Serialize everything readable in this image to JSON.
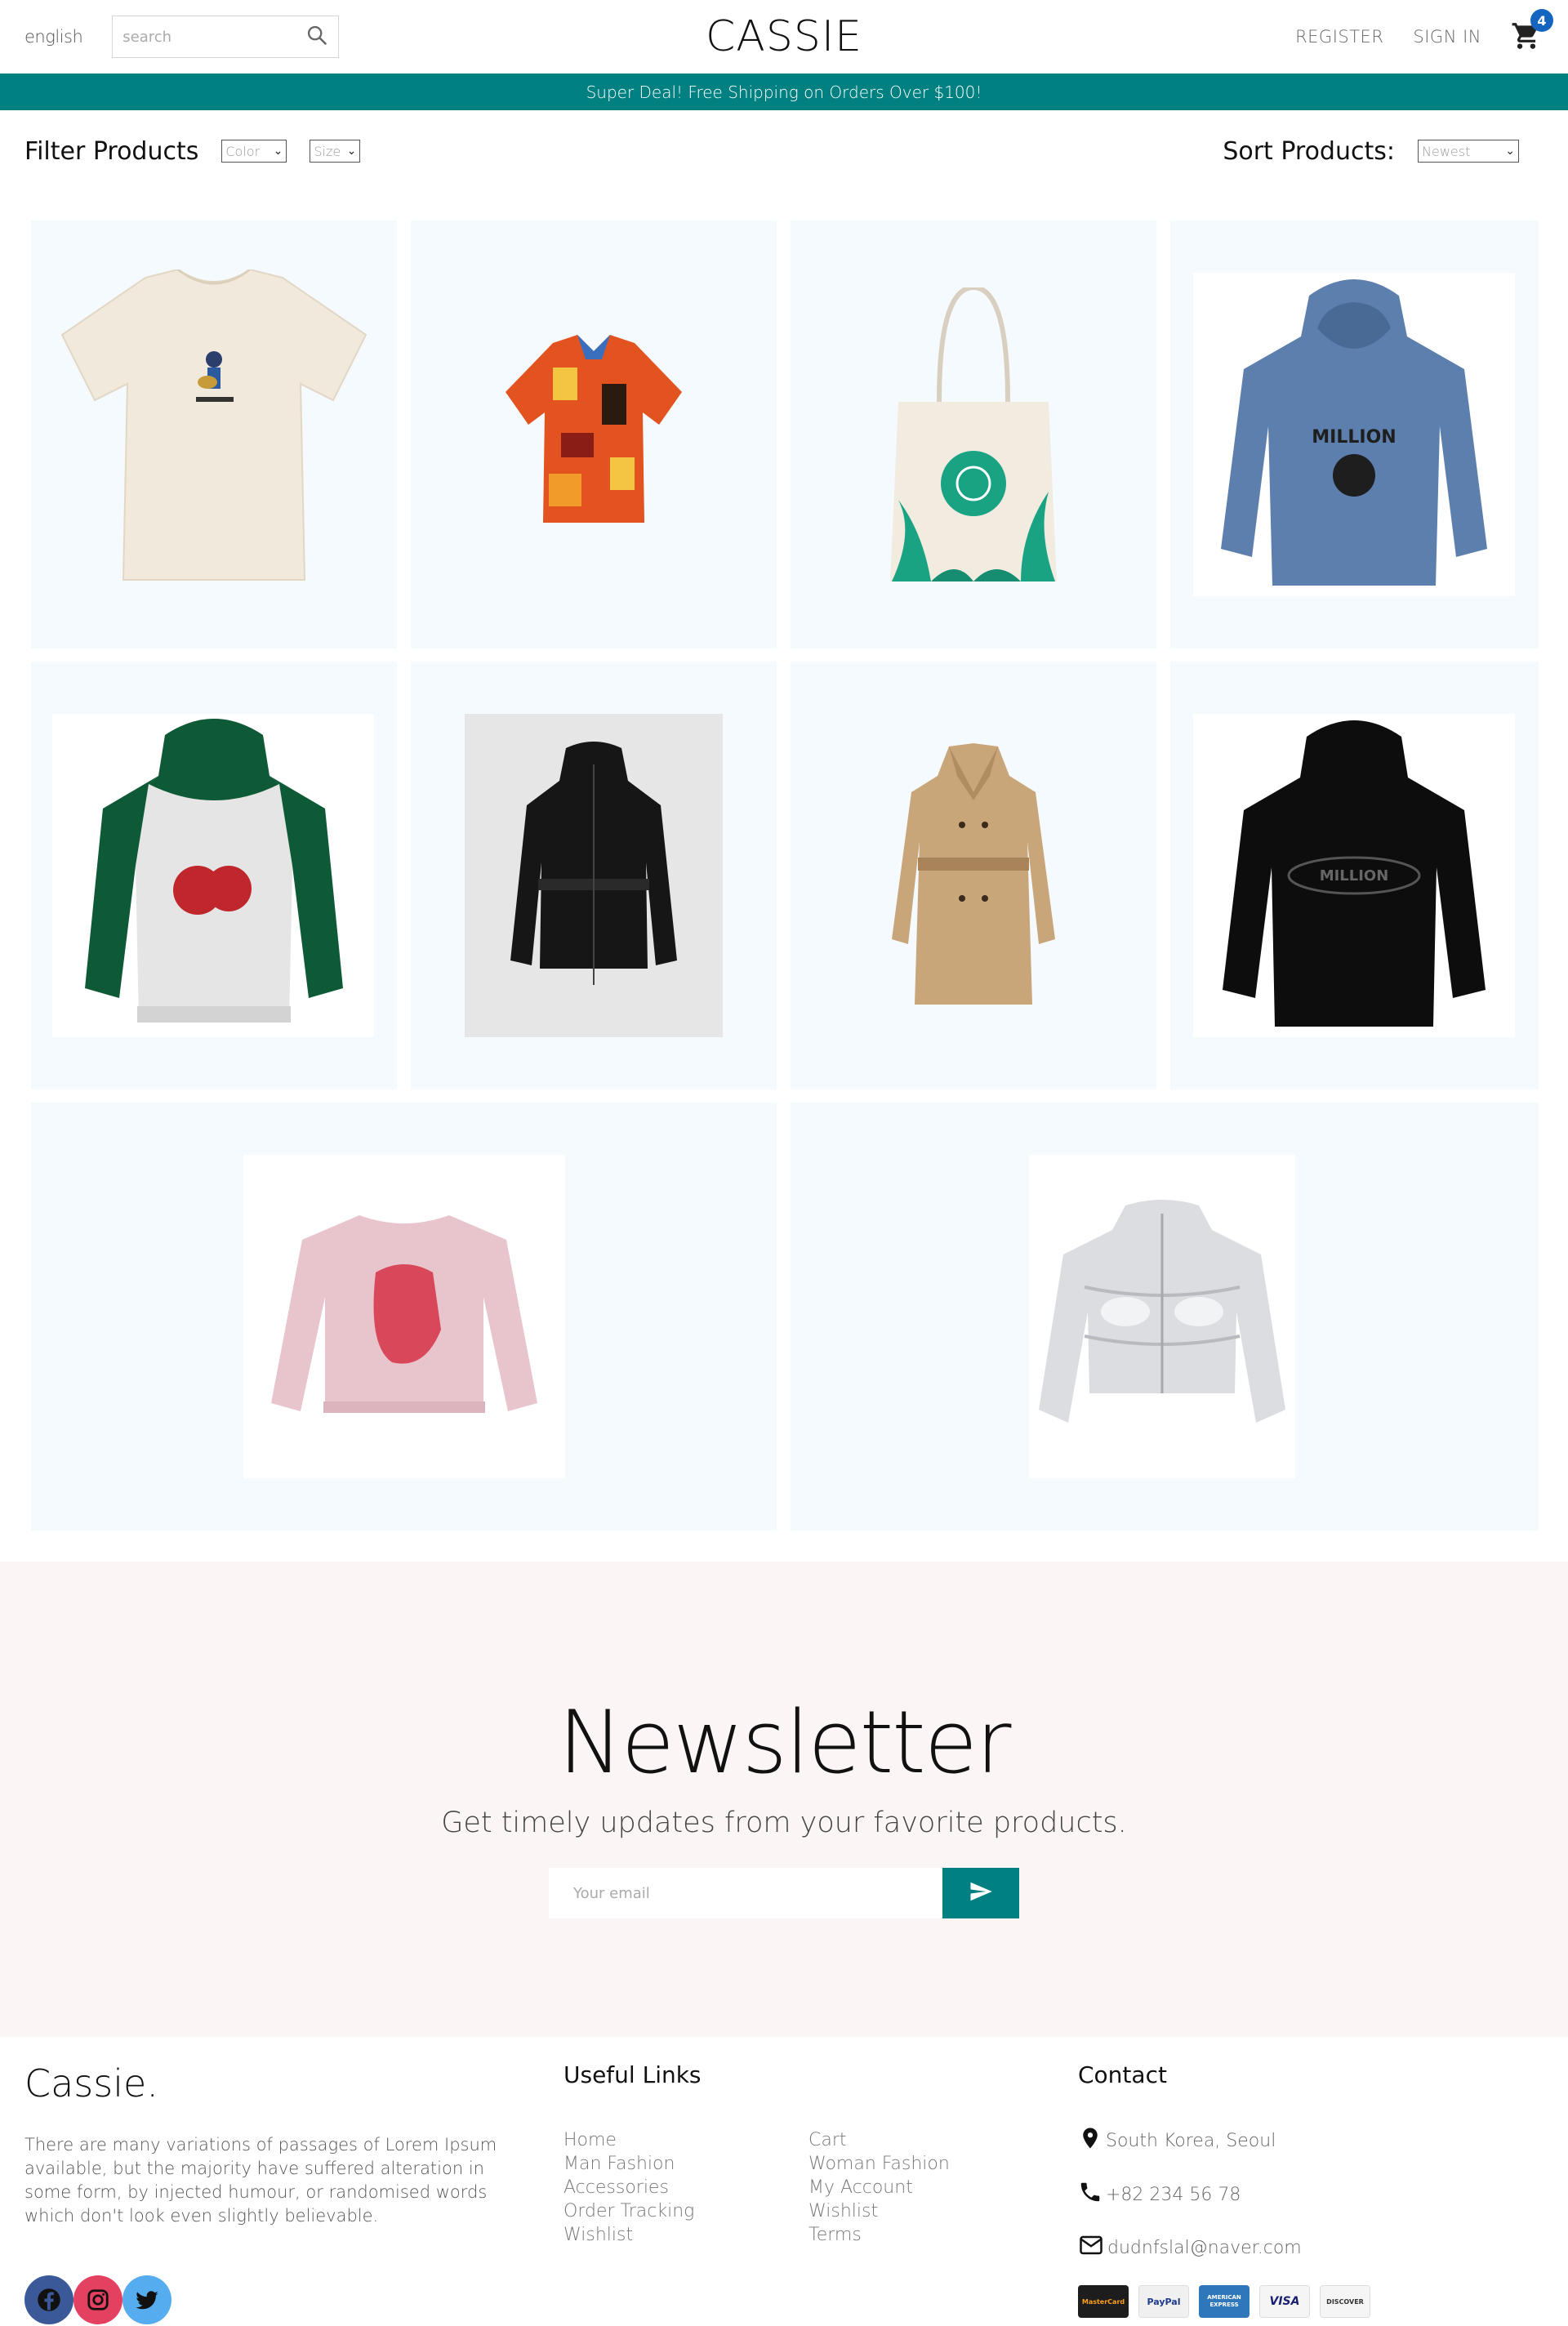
{
  "navbar": {
    "language": "english",
    "search_placeholder": "search",
    "logo": "CASSIE",
    "register": "REGISTER",
    "sign_in": "SIGN IN",
    "cart_count": "4"
  },
  "announcement": "Super Deal! Free Shipping on Orders Over $100!",
  "filter": {
    "title": "Filter Products",
    "color_option": "Color",
    "size_option": "Size",
    "sort_title": "Sort Products:",
    "sort_option": "Newest"
  },
  "products": [
    {
      "name": "T-shirt",
      "icon": "tshirt-icon"
    },
    {
      "name": "Pattern shirt",
      "icon": "shirt-icon"
    },
    {
      "name": "Tote bag",
      "icon": "tote-bag-icon"
    },
    {
      "name": "Blue hoodie",
      "icon": "hoodie-icon"
    },
    {
      "name": "Cherry hoodie",
      "icon": "hoodie-icon"
    },
    {
      "name": "Black puffer jacket",
      "icon": "jacket-icon"
    },
    {
      "name": "Trench coat",
      "icon": "coat-icon"
    },
    {
      "name": "Black hoodie",
      "icon": "hoodie-icon"
    },
    {
      "name": "Pink sweater",
      "icon": "sweater-icon"
    },
    {
      "name": "Silver puffer jacket",
      "icon": "jacket-icon"
    }
  ],
  "newsletter": {
    "title": "Newsletter",
    "subtitle": "Get timely updates from your favorite products.",
    "email_placeholder": "Your email"
  },
  "footer": {
    "logo": "Cassie.",
    "description": "There are many variations of passages of Lorem Ipsum available, but the majority have suffered alteration in some form, by injected humour, or randomised words which don't look even slightly believable.",
    "useful_links_title": "Useful Links",
    "links_col1": [
      "Home",
      "Man Fashion",
      "Accessories",
      "Order Tracking",
      "Wishlist"
    ],
    "links_col2": [
      "Cart",
      "Woman Fashion",
      "My Account",
      "Wishlist",
      "Terms"
    ],
    "contact_title": "Contact",
    "address": "South Korea, Seoul",
    "phone": "+82 234 56 78",
    "email": "dudnfslal@naver.com",
    "payments": [
      "MasterCard",
      "PayPal",
      "AMERICAN EXPRESS",
      "VISA",
      "DISCOVER"
    ]
  },
  "colors": {
    "accent": "#008080",
    "badge": "#1565c0",
    "card_bg": "#f4fafd",
    "newsletter_bg": "#fbf5f5"
  }
}
